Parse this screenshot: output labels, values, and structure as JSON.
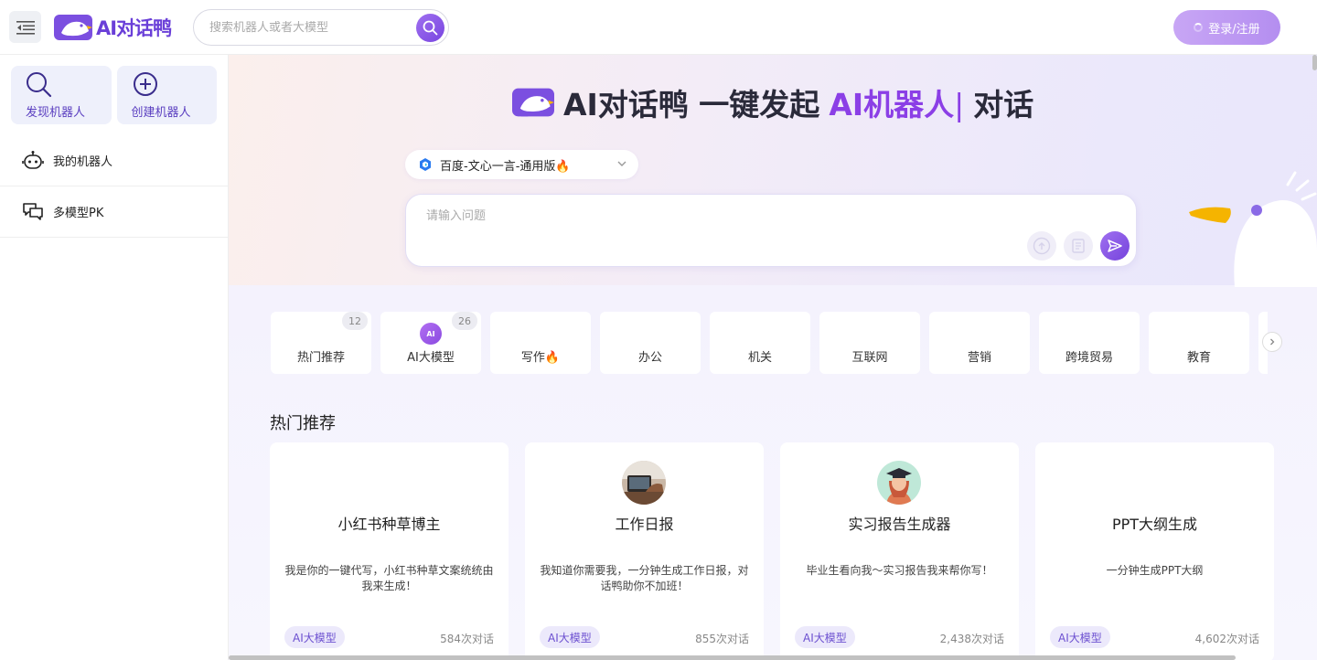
{
  "header": {
    "logo_text": "AI对话鸭",
    "search_placeholder": "搜索机器人或者大模型",
    "login_label": "登录/注册"
  },
  "sidebar": {
    "actions": [
      {
        "label": "发现机器人",
        "icon": "search-icon"
      },
      {
        "label": "创建机器人",
        "icon": "plus-circle-icon"
      }
    ],
    "items": [
      {
        "label": "我的机器人",
        "icon": "robot-icon"
      },
      {
        "label": "多模型PK",
        "icon": "chat-bubbles-icon"
      }
    ]
  },
  "hero": {
    "title_prefix": "AI对话鸭 一键发起",
    "title_accent": "AI机器人",
    "title_cursor": "|",
    "title_suffix": "对话",
    "model_select": "百度-文心一言-通用版🔥",
    "input_placeholder": "请输入问题"
  },
  "categories": [
    {
      "label": "热门推荐",
      "count": "12"
    },
    {
      "label": "AI大模型",
      "count": "26",
      "icon": "ai-badge-icon"
    },
    {
      "label": "写作🔥"
    },
    {
      "label": "办公"
    },
    {
      "label": "机关"
    },
    {
      "label": "互联网"
    },
    {
      "label": "营销"
    },
    {
      "label": "跨境贸易"
    },
    {
      "label": "教育"
    }
  ],
  "section_title": "热门推荐",
  "cards": [
    {
      "title": "小红书种草博主",
      "desc": "我是你的一键代写，小红书种草文案统统由我来生成！",
      "tag": "AI大模型",
      "count": "584次对话",
      "avatar": "none"
    },
    {
      "title": "工作日报",
      "desc": "我知道你需要我，一分钟生成工作日报，对话鸭助你不加班！",
      "tag": "AI大模型",
      "count": "855次对话",
      "avatar": "workdesk-avatar"
    },
    {
      "title": "实习报告生成器",
      "desc": "毕业生看向我～实习报告我来帮你写！",
      "tag": "AI大模型",
      "count": "2,438次对话",
      "avatar": "graduate-avatar"
    },
    {
      "title": "PPT大纲生成",
      "desc": "一分钟生成PPT大纲",
      "tag": "AI大模型",
      "count": "4,602次对话",
      "avatar": "none"
    }
  ],
  "colors": {
    "brand": "#6a3fd8",
    "accent": "#8b3fe6",
    "login_bg": "#c2a0f4",
    "tag_bg": "#ece9fb"
  }
}
